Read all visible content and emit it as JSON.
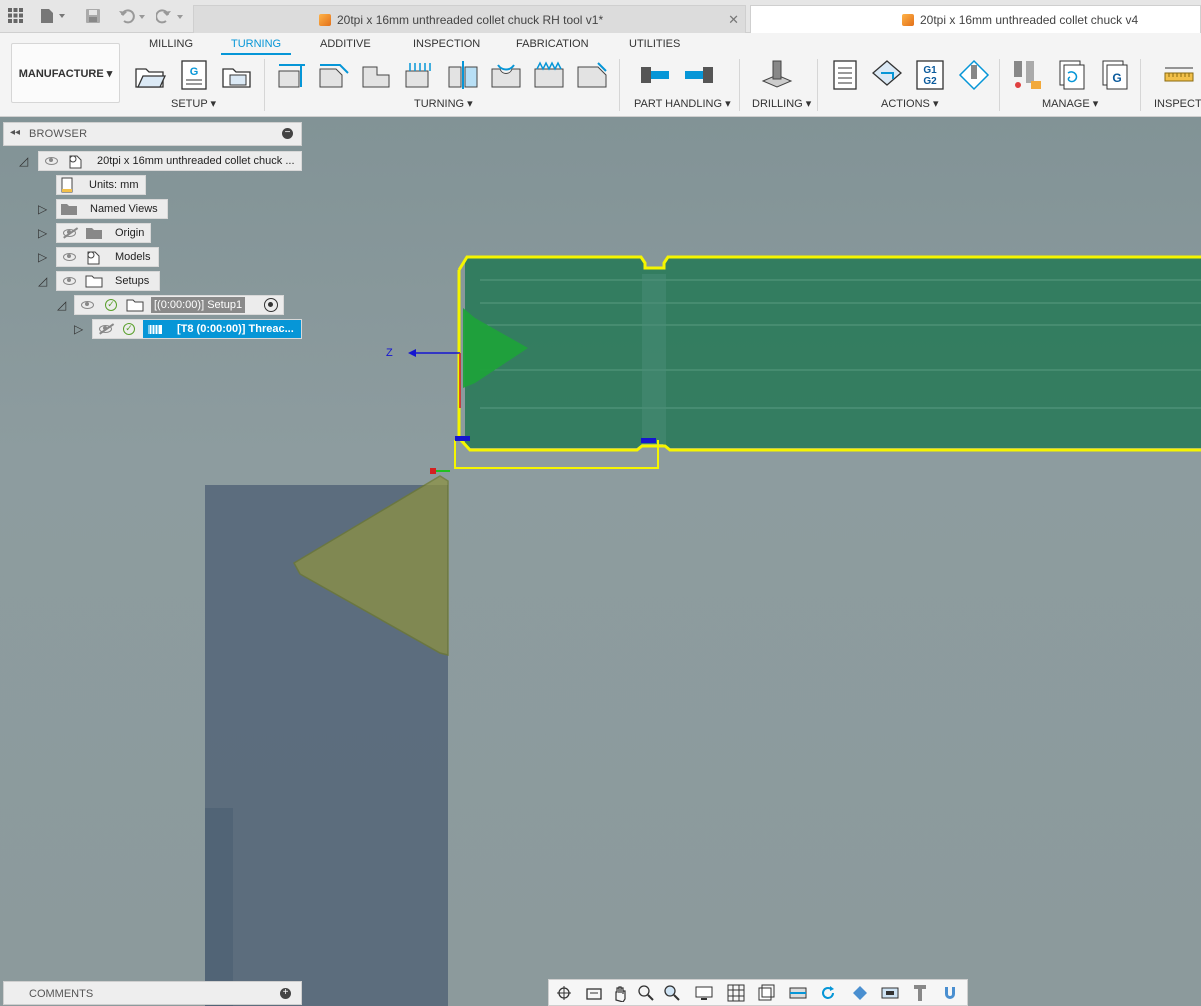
{
  "top_bar": {
    "tab1_title": "20tpi x 16mm unthreaded collet chuck RH tool v1*",
    "tab2_title": "20tpi x 16mm unthreaded collet chuck v4",
    "close_glyph": "✕"
  },
  "ribbon": {
    "workspace": "MANUFACTURE ▾",
    "tabs": [
      "MILLING",
      "TURNING",
      "ADDITIVE",
      "INSPECTION",
      "FABRICATION",
      "UTILITIES"
    ],
    "active_tab": "TURNING",
    "groups": {
      "setup": "SETUP ▾",
      "turning": "TURNING ▾",
      "part_handling": "PART HANDLING ▾",
      "drilling": "DRILLING ▾",
      "actions": "ACTIONS ▾",
      "manage": "MANAGE ▾",
      "inspect": "INSPECT ▾"
    },
    "g1g2_text": [
      "G1",
      "G2"
    ],
    "g_text": "G"
  },
  "browser": {
    "title": "BROWSER",
    "root": "20tpi x 16mm unthreaded collet chuck ...",
    "units": "Units: mm",
    "named_views": "Named Views",
    "origin": "Origin",
    "models": "Models",
    "setups": "Setups",
    "setup1": "[(0:00:00)] Setup1",
    "operation": "[T8 (0:00:00)] Threac..."
  },
  "comments": {
    "title": "COMMENTS"
  },
  "viewport": {
    "axis_label": "Z"
  },
  "colors": {
    "accent": "#0696d7",
    "part_green": "#2a7a5a",
    "outline_yellow": "#f5f500",
    "insert_olive": "#7f8f3a",
    "holder_slate": "#56687a"
  }
}
